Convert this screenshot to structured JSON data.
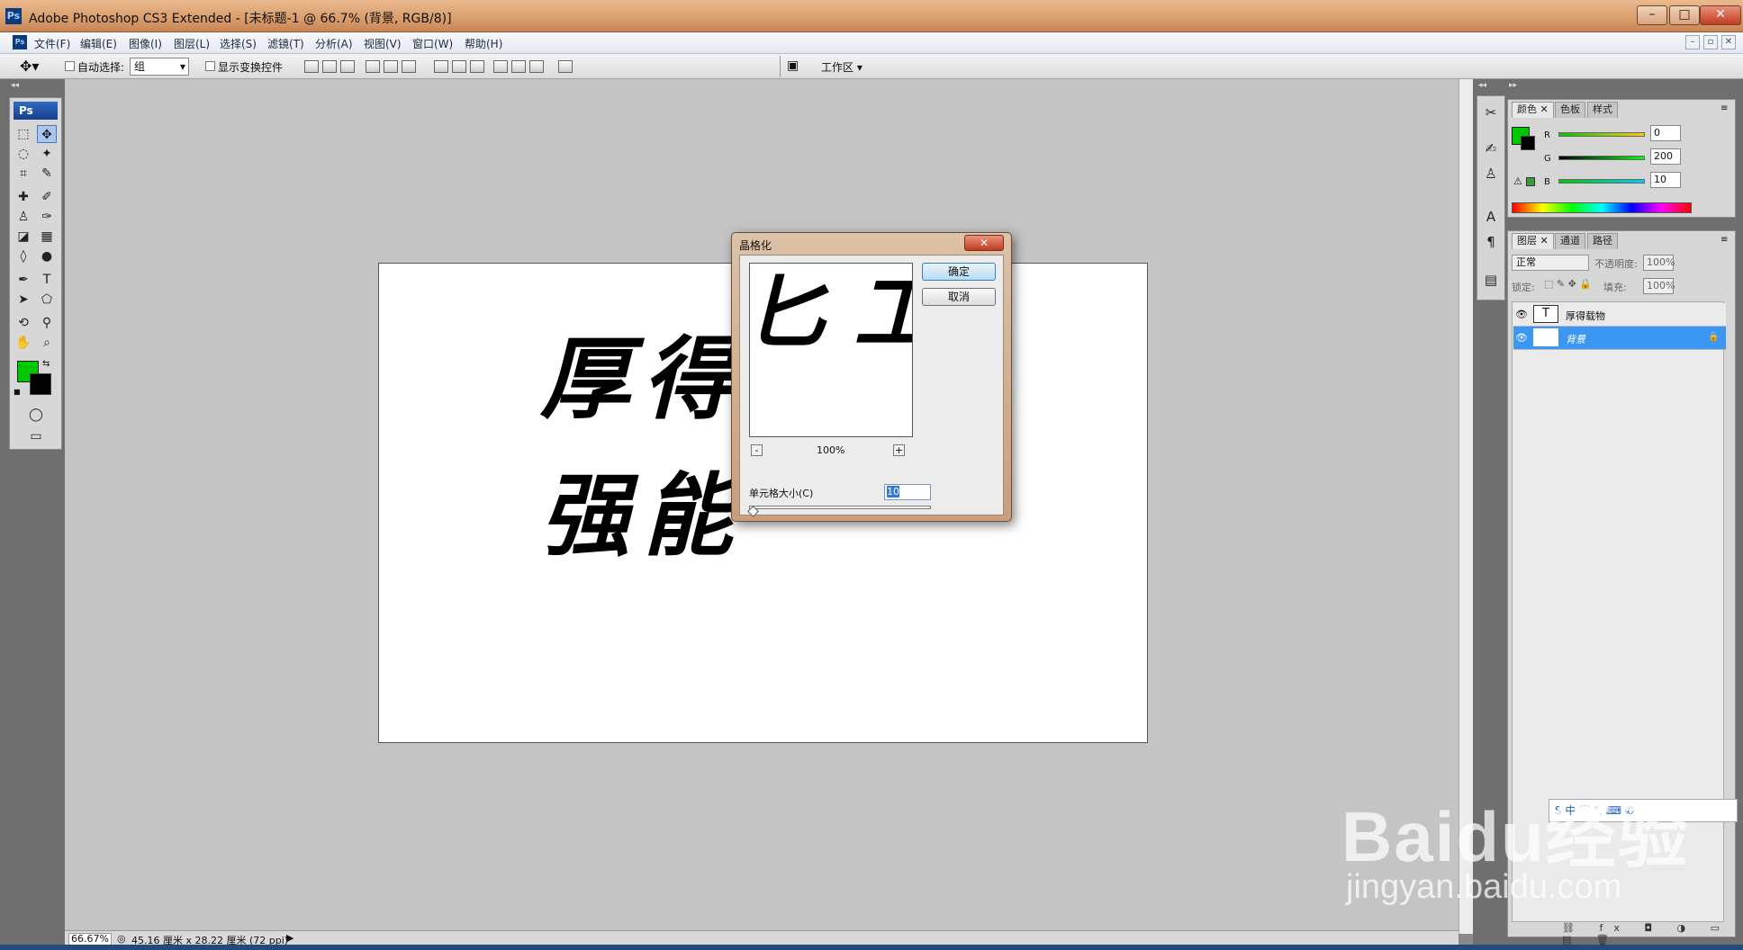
{
  "window": {
    "title": "Adobe Photoshop CS3 Extended - [未标题-1 @ 66.7% (背景, RGB/8)]",
    "app_icon": "Ps",
    "controls": [
      "minimize",
      "maximize",
      "close"
    ]
  },
  "menu": {
    "items": [
      "文件(F)",
      "编辑(E)",
      "图像(I)",
      "图层(L)",
      "选择(S)",
      "滤镜(T)",
      "分析(A)",
      "视图(V)",
      "窗口(W)",
      "帮助(H)"
    ]
  },
  "options_bar": {
    "auto_select_label": "自动选择:",
    "auto_select_value": "组",
    "show_transform_label": "显示变换控件",
    "workspace_label": "工作区"
  },
  "toolbox": {
    "logo": "Ps",
    "foreground_color": "#00c800",
    "background_color": "#000000"
  },
  "canvas": {
    "line1": "厚得",
    "line2": "强能"
  },
  "status": {
    "zoom": "66.67%",
    "doc_size": "45.16 厘米 x 28.22 厘米 (72 ppi)"
  },
  "dialog": {
    "title": "晶格化",
    "ok": "确定",
    "cancel": "取消",
    "zoom": "100%",
    "zoom_minus": "-",
    "zoom_plus": "+",
    "cell_size_label": "单元格大小(C)",
    "cell_size_value": "10",
    "preview_text": "匕 工"
  },
  "color_panel": {
    "tabs": [
      "颜色",
      "色板",
      "样式"
    ],
    "r_label": "R",
    "r_value": "0",
    "g_label": "G",
    "g_value": "200",
    "b_label": "B",
    "b_value": "10"
  },
  "layers_panel": {
    "tabs": [
      "图层",
      "通道",
      "路径"
    ],
    "blend_mode": "正常",
    "opacity_label": "不透明度:",
    "opacity_value": "100%",
    "lock_label": "锁定:",
    "fill_label": "填充:",
    "fill_value": "100%",
    "layers": [
      {
        "name": "厚得载物",
        "thumb": "T"
      },
      {
        "name": "背景",
        "thumb": ""
      }
    ]
  },
  "watermark": {
    "brand": "Baidu经验",
    "url": "jingyan.baidu.com"
  },
  "ime": {
    "text": "S 中 ⌒ °, ⌨ ✆"
  }
}
